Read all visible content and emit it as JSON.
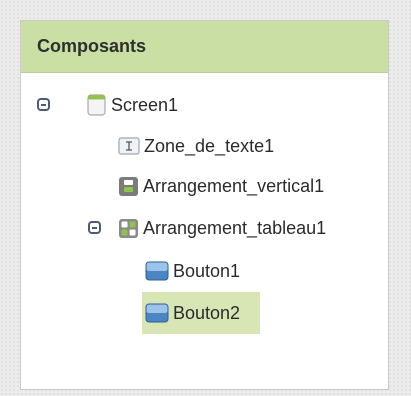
{
  "panel": {
    "title": "Composants"
  },
  "tree": {
    "items": [
      {
        "label": "Screen1",
        "icon": "screen-icon",
        "expanded": true
      },
      {
        "label": "Zone_de_texte1",
        "icon": "textbox-icon"
      },
      {
        "label": "Arrangement_vertical1",
        "icon": "vertical-arrangement-icon"
      },
      {
        "label": "Arrangement_tableau1",
        "icon": "table-arrangement-icon",
        "expanded": true
      },
      {
        "label": "Bouton1",
        "icon": "button-icon"
      },
      {
        "label": "Bouton2",
        "icon": "button-icon",
        "selected": true
      }
    ]
  },
  "colors": {
    "header_bg": "#c9dfa3",
    "selection_bg": "#d7e6b4",
    "toggle": "#505a78"
  }
}
